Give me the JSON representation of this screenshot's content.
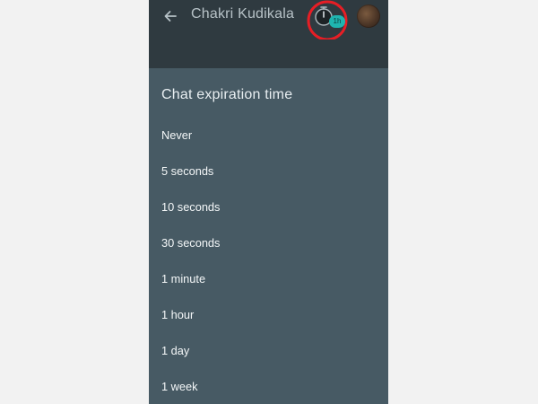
{
  "toolbar": {
    "contact_name": "Chakri Kudikala",
    "timer_badge": "1h",
    "highlight_color": "#e61e25",
    "toolbar_color": "#2f3a40",
    "accent_color": "#1fb5b0",
    "icons": {
      "back": "arrow-left-icon",
      "timer": "stopwatch-icon"
    }
  },
  "sheet": {
    "title": "Chat expiration time",
    "background_color": "#475a64",
    "options": [
      {
        "label": "Never"
      },
      {
        "label": "5 seconds"
      },
      {
        "label": "10 seconds"
      },
      {
        "label": "30 seconds"
      },
      {
        "label": "1 minute"
      },
      {
        "label": "1 hour"
      },
      {
        "label": "1 day"
      },
      {
        "label": "1 week"
      }
    ]
  }
}
